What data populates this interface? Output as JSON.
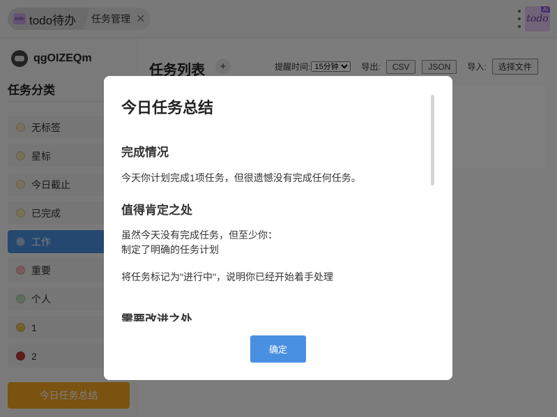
{
  "tabs": {
    "home_label": "todo待办",
    "home_logo": "todo",
    "current_label": "任务管理",
    "close_glyph": "✕"
  },
  "app_logo": {
    "text": "todo",
    "badge": "Ai"
  },
  "user": {
    "name": "qgOIZEQm"
  },
  "sidebar": {
    "title": "任务分类",
    "items": [
      {
        "label": "无标签",
        "color": "#f1e0b0"
      },
      {
        "label": "星标",
        "color": "#f1e0b0"
      },
      {
        "label": "今日截止",
        "color": "#f1e0b0"
      },
      {
        "label": "已完成",
        "color": "#f1e0b0"
      },
      {
        "label": "工作",
        "color": "#a9c6ea",
        "active": true
      },
      {
        "label": "重要",
        "color": "#f5b3b8"
      },
      {
        "label": "个人",
        "color": "#b7dcb8"
      },
      {
        "label": "1",
        "color": "#e3bf5c"
      },
      {
        "label": "2",
        "color": "#c0393b"
      }
    ],
    "summary_button": "今日任务总结"
  },
  "main": {
    "title": "任务列表",
    "add_glyph": "+",
    "reminder_label": "提醒时间:",
    "reminder_value": "15分钟",
    "export_label": "导出:",
    "export_csv": "CSV",
    "export_json": "JSON",
    "import_label": "导入:",
    "import_button": "选择文件"
  },
  "modal": {
    "title": "今日任务总结",
    "section1_title": "完成情况",
    "section1_text": "今天你计划完成1项任务，但很遗憾没有完成任何任务。",
    "section2_title": "值得肯定之处",
    "section2_line1": "虽然今天没有完成任务，但至少你：",
    "section2_line2": "制定了明确的任务计划",
    "section2_line3": "将任务标记为\"进行中\"，说明你已经开始着手处理",
    "section3_title": "需要改进之处",
    "confirm_button": "确定"
  }
}
